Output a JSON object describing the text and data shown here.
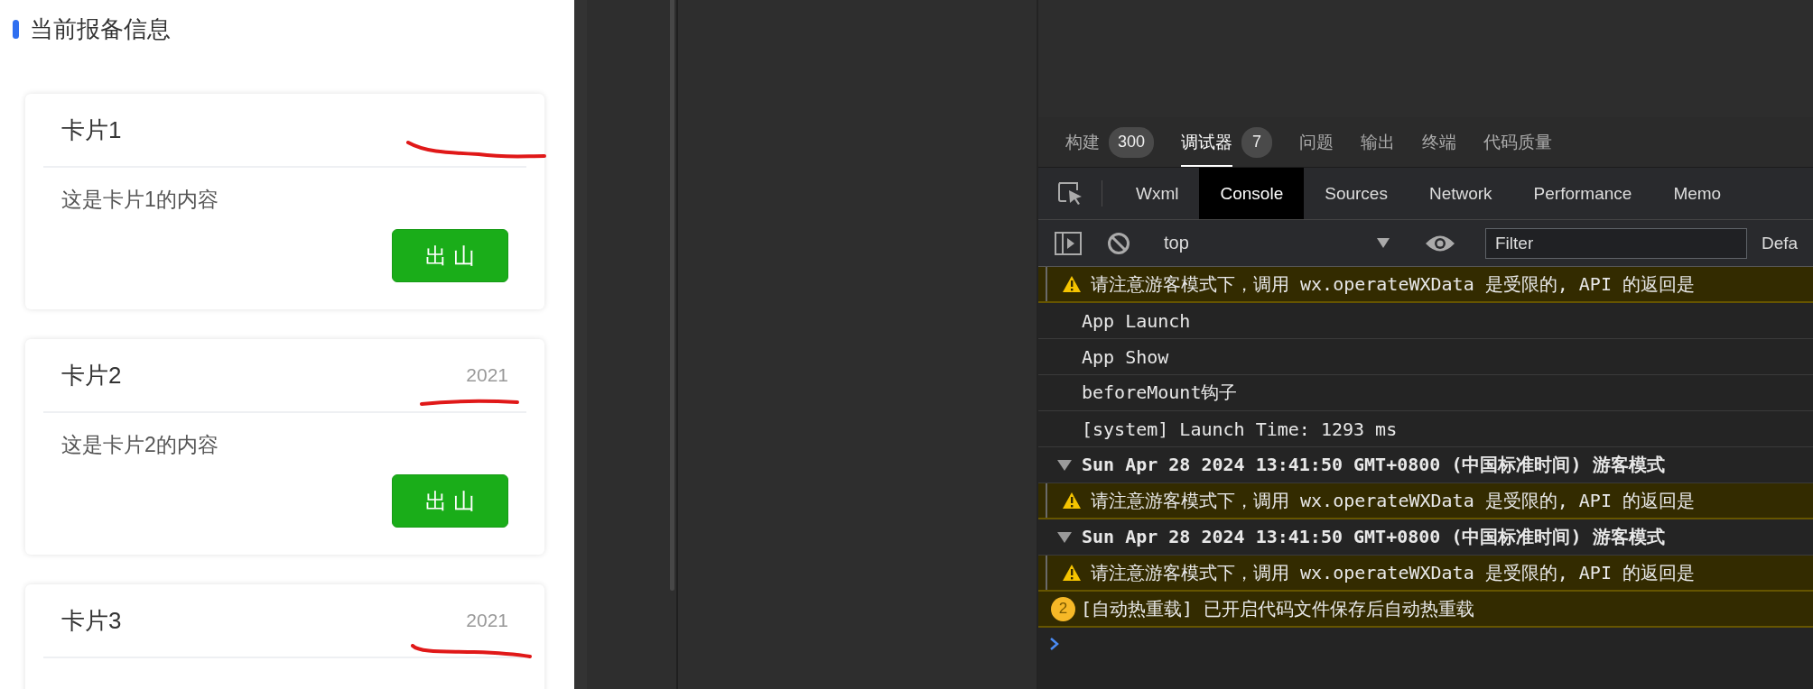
{
  "page": {
    "heading": "当前报备信息",
    "cards": [
      {
        "title": "卡片1",
        "content": "这是卡片1的内容",
        "button": "出 山"
      },
      {
        "title": "卡片2",
        "extra": "2021",
        "content": "这是卡片2的内容",
        "button": "出 山"
      },
      {
        "title": "卡片3",
        "extra": "2021"
      }
    ]
  },
  "devtools": {
    "panel_tabs": [
      {
        "label": "构建",
        "badge": "300",
        "selected": false
      },
      {
        "label": "调试器",
        "badge": "7",
        "selected": true
      },
      {
        "label": "问题",
        "selected": false
      },
      {
        "label": "输出",
        "selected": false
      },
      {
        "label": "终端",
        "selected": false
      },
      {
        "label": "代码质量",
        "selected": false
      }
    ],
    "tool_tabs": [
      {
        "label": "Wxml",
        "selected": false
      },
      {
        "label": "Console",
        "selected": true
      },
      {
        "label": "Sources",
        "selected": false
      },
      {
        "label": "Network",
        "selected": false
      },
      {
        "label": "Performance",
        "selected": false
      },
      {
        "label": "Memo",
        "selected": false
      }
    ],
    "toolbar": {
      "context": "top",
      "filter": {
        "placeholder": "Filter"
      },
      "levels": "Defa"
    },
    "console": [
      {
        "kind": "warning",
        "text": "请注意游客模式下，调用 wx.operateWXData 是受限的, API 的返回是"
      },
      {
        "kind": "log",
        "text": "App Launch"
      },
      {
        "kind": "log",
        "text": "App Show"
      },
      {
        "kind": "log",
        "text": "beforeMount钩子"
      },
      {
        "kind": "log",
        "text": "[system] Launch Time: 1293 ms"
      },
      {
        "kind": "group",
        "expanded": true,
        "text": "Sun Apr 28 2024 13:41:50 GMT+0800 (中国标准时间) 游客模式"
      },
      {
        "kind": "warning",
        "text": "请注意游客模式下，调用 wx.operateWXData 是受限的, API 的返回是"
      },
      {
        "kind": "group",
        "expanded": true,
        "text": "Sun Apr 28 2024 13:41:50 GMT+0800 (中国标准时间) 游客模式"
      },
      {
        "kind": "warning",
        "text": "请注意游客模式下，调用 wx.operateWXData 是受限的, API 的返回是"
      },
      {
        "kind": "info",
        "count": "2",
        "text": "[自动热重载] 已开启代码文件保存后自动热重载"
      }
    ]
  }
}
